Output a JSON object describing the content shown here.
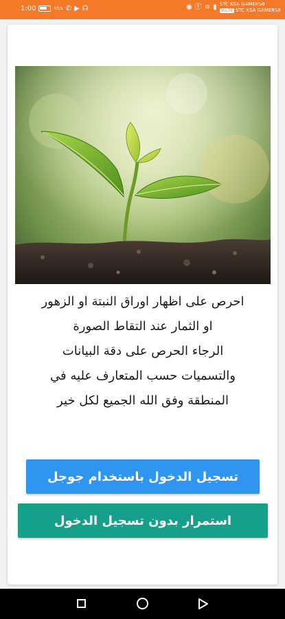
{
  "status_bar": {
    "time": "1:00",
    "speed": "KB/s",
    "carrier_1": "STC KSA GAMERS8",
    "carrier_2": "STC KSA GAMERS8",
    "volte": "VoLTE",
    "icons": [
      "battery-icon",
      "whatsapp-icon",
      "youtube-icon",
      "headset-icon",
      "nfc-icon",
      "facebook-icon",
      "wifi-icon",
      "signal-icon"
    ]
  },
  "content": {
    "image_description": "plant-seedling-photo",
    "instructions": [
      "احرص على اظهار اوراق النبتة او الزهور",
      "او الثمار عند التقاط الصورة",
      "الرجاء الحرص على دقة البيانات",
      "والتسميات حسب المتعارف عليه في",
      "المنطقة وفق الله الجميع لكل خير"
    ],
    "google_login_label": "تسجيل الدخول باستخدام جوجل",
    "continue_without_login_label": "استمرار بدون تسجيل الدخول"
  },
  "colors": {
    "status_bar": "#f47a2a",
    "google_button": "#2f96ef",
    "guest_button": "#16a08a"
  },
  "nav_bar": {
    "icons": [
      "recent-apps-icon",
      "home-icon",
      "back-icon"
    ]
  }
}
